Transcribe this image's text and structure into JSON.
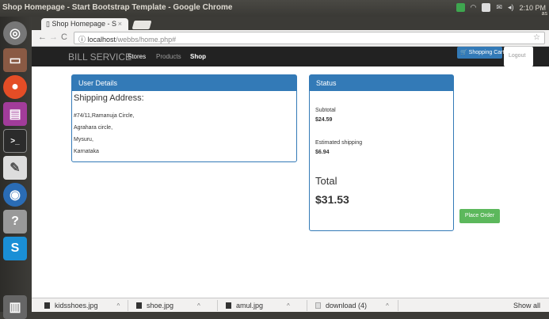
{
  "os": {
    "window_title": "Shop Homepage - Start Bootstrap Template - Google Chrome",
    "clock": "2:10 PM",
    "user_initials": "as"
  },
  "browser": {
    "tab_title": "Shop Homepage - S",
    "tab_close": "×",
    "url_host": "localhost",
    "url_path": "/webbs/home.php#",
    "back": "←",
    "forward": "→",
    "reload": "C",
    "info": "ⓘ",
    "star": "☆"
  },
  "navbar": {
    "brand": "BILL SERVICE",
    "links": [
      "Stores",
      "Products",
      "Shop"
    ],
    "cart": "Shopping Cart",
    "logout": "Logout"
  },
  "user_details": {
    "heading": "User Details",
    "shipping_title": "Shipping Address:",
    "address": [
      "#74/11,Ramanuja Circle,",
      "Agrahara circle,",
      "Mysuru,",
      "Karnataka"
    ]
  },
  "status": {
    "heading": "Status",
    "subtotal_label": "Subtotal",
    "subtotal_value": "$24.59",
    "shipping_label": "Estimated shipping",
    "shipping_value": "$6.94",
    "total_label": "Total",
    "total_value": "$31.53"
  },
  "place_order": "Place Order",
  "downloads": {
    "items": [
      "kidsshoes.jpg",
      "shoe.jpg",
      "amul.jpg",
      "download (4)"
    ],
    "show_all": "Show all"
  }
}
